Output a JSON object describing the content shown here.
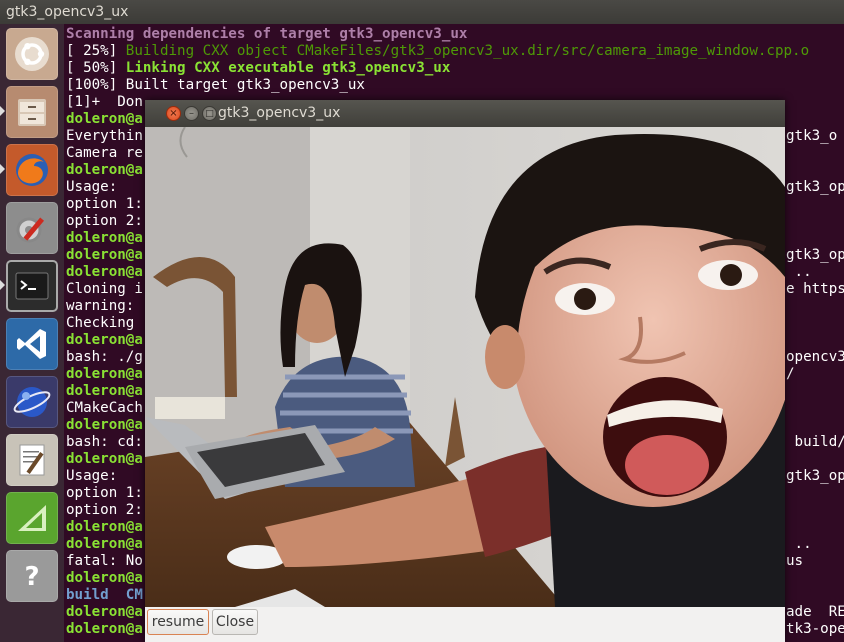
{
  "topbar": {
    "title": "gtk3_opencv3_ux"
  },
  "launcher": {
    "items": [
      {
        "name": "ubuntu-logo-icon"
      },
      {
        "name": "file-cabinet-icon"
      },
      {
        "name": "firefox-icon"
      },
      {
        "name": "system-settings-icon"
      },
      {
        "name": "terminal-icon"
      },
      {
        "name": "vscode-icon"
      },
      {
        "name": "globe-icon"
      },
      {
        "name": "text-editor-icon"
      },
      {
        "name": "geometry-app-icon"
      },
      {
        "name": "help-question-icon"
      }
    ]
  },
  "terminal": {
    "lines": [
      {
        "text": "Scanning dependencies of target gtk3_opencv3_ux",
        "style": "magenta"
      },
      {
        "text": "[ 25%] Building CXX object CMakeFiles/gtk3_opencv3_ux.dir/src/camera_image_window.cpp.o",
        "style": "green-n",
        "prefix": "[ 25%] "
      },
      {
        "text": "[ 50%] Linking CXX executable gtk3_opencv3_ux",
        "style": "green",
        "prefix": "[ 50%] "
      },
      {
        "text": "[100%] Built target gtk3_opencv3_ux",
        "style": "white"
      },
      {
        "text": "[1]+  Don",
        "style": "white"
      },
      {
        "text": "doleron@a",
        "style": "green"
      },
      {
        "text": "Everythin",
        "style": "white"
      },
      {
        "text": "Camera re",
        "style": "white"
      },
      {
        "text": "doleron@a",
        "style": "green"
      },
      {
        "text": "Usage:",
        "style": "white"
      },
      {
        "text": "option 1:",
        "style": "white"
      },
      {
        "text": "option 2:",
        "style": "white"
      },
      {
        "text": "doleron@a",
        "style": "green"
      },
      {
        "text": "doleron@a",
        "style": "green"
      },
      {
        "text": "doleron@a",
        "style": "green"
      },
      {
        "text": "Cloning i",
        "style": "white"
      },
      {
        "text": "warning:",
        "style": "white"
      },
      {
        "text": "Checking",
        "style": "white"
      },
      {
        "text": "doleron@a",
        "style": "green"
      },
      {
        "text": "bash: ./g",
        "style": "white"
      },
      {
        "text": "doleron@a",
        "style": "green"
      },
      {
        "text": "doleron@a",
        "style": "green"
      },
      {
        "text": "CMakeCach",
        "style": "white"
      },
      {
        "text": "doleron@a",
        "style": "green"
      },
      {
        "text": "bash: cd:",
        "style": "white"
      },
      {
        "text": "doleron@a",
        "style": "green"
      },
      {
        "text": "Usage:",
        "style": "white"
      },
      {
        "text": "option 1:",
        "style": "white"
      },
      {
        "text": "option 2:",
        "style": "white"
      },
      {
        "text": "doleron@a",
        "style": "green"
      },
      {
        "text": "doleron@a",
        "style": "green"
      },
      {
        "text": "fatal: No",
        "style": "white"
      },
      {
        "text": "doleron@a",
        "style": "green"
      },
      {
        "text": "build  CM",
        "style": "blue"
      },
      {
        "text": "doleron@a",
        "style": "green"
      },
      {
        "text": "doleron@a",
        "style": "green"
      }
    ],
    "right_fragments": [
      {
        "text": "gtk3_o",
        "line": 6
      },
      {
        "text": "gtk3_op",
        "line": 9
      },
      {
        "text": "gtk3_op",
        "line": 13
      },
      {
        "text": " ..",
        "line": 14
      },
      {
        "text": "e https",
        "line": 15
      },
      {
        "text": "opencv3_",
        "line": 19
      },
      {
        "text": "/",
        "line": 20
      },
      {
        "text": " build/",
        "line": 24
      },
      {
        "text": "gtk3_op",
        "line": 26
      },
      {
        "text": " ..",
        "line": 30
      },
      {
        "text": "us",
        "line": 31
      },
      {
        "text": "ade  RE",
        "line": 34
      },
      {
        "text": "tk3-ope",
        "line": 35
      }
    ]
  },
  "window": {
    "title": "gtk3_opencv3_ux",
    "close_glyph": "×",
    "minimize_glyph": "–",
    "maximize_glyph": "□",
    "buttons": {
      "resume": "resume",
      "close": "Close"
    }
  }
}
